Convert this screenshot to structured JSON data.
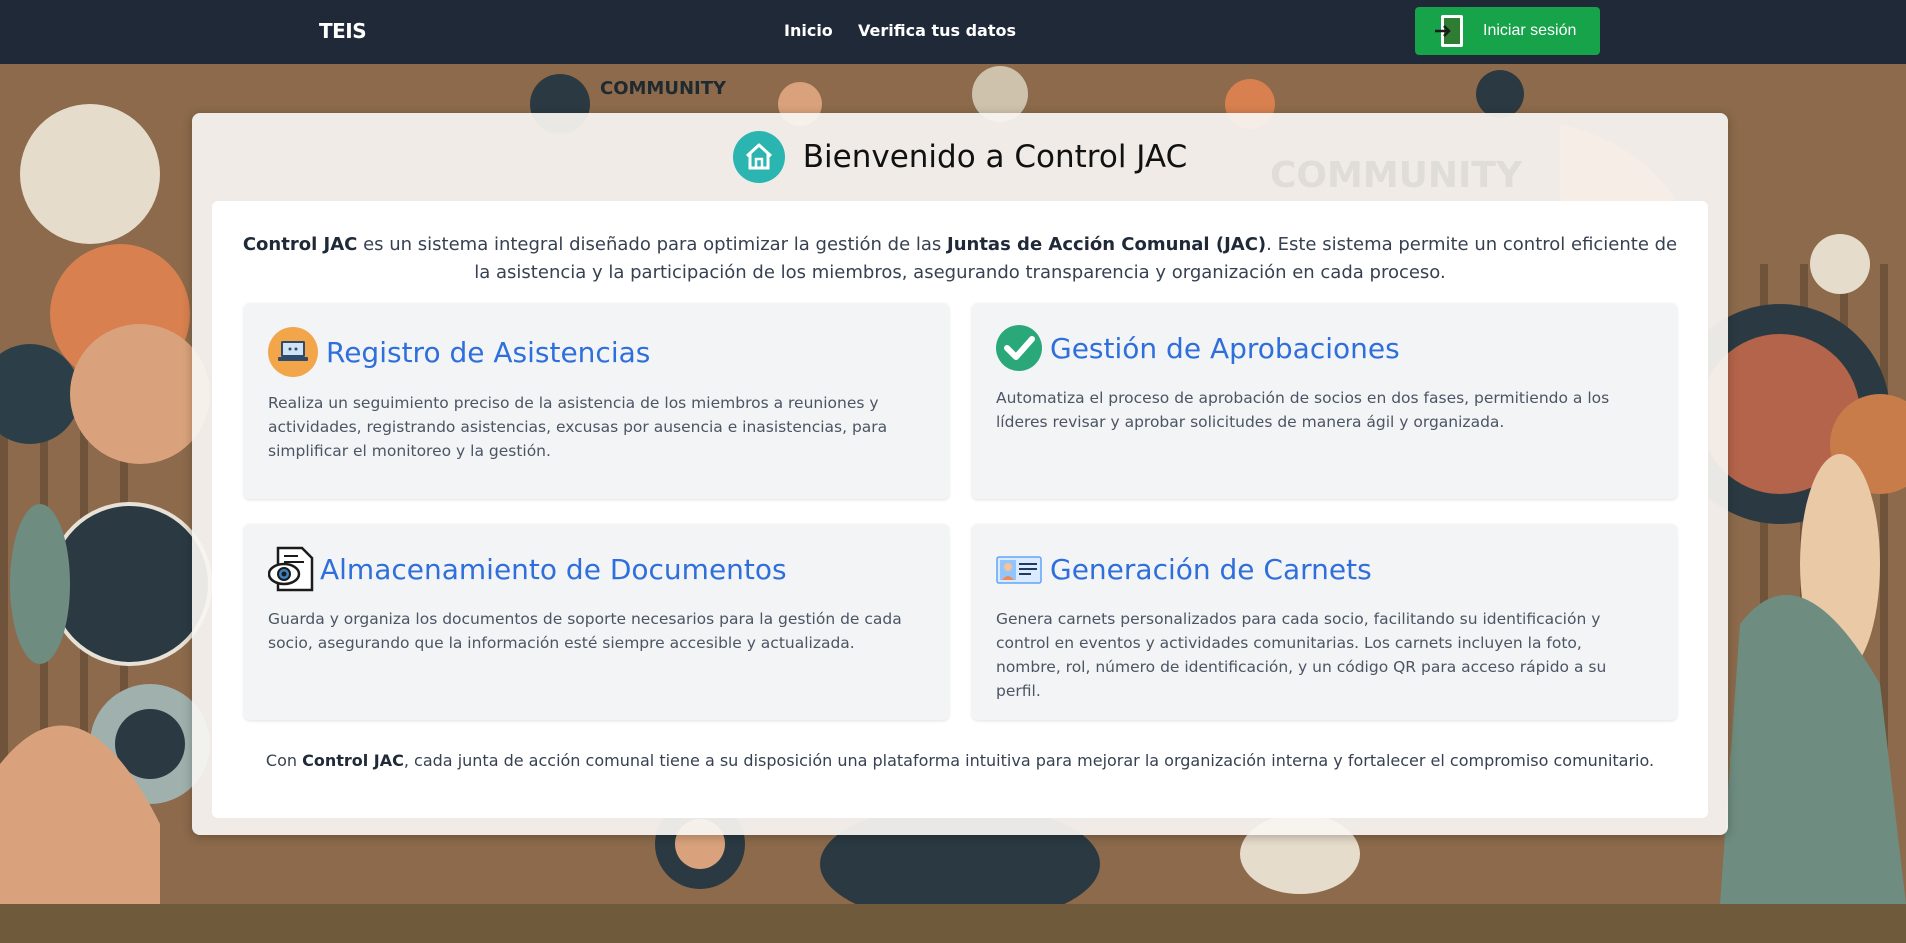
{
  "navbar": {
    "brand": "TEIS",
    "links": [
      "Inicio",
      "Verifica tus datos"
    ],
    "login_label": "Iniciar sesión"
  },
  "background": {
    "art_text_1": "COMMUNITY",
    "art_text_2": "COMMUNITY"
  },
  "main": {
    "title": "Bienvenido a Control JAC",
    "intro": {
      "part1": "Control JAC",
      "part2": " es un sistema integral diseñado para optimizar la gestión de las ",
      "part3": "Juntas de Acción Comunal (JAC)",
      "part4": ". Este sistema permite un control eficiente de la asistencia y la participación de los miembros, asegurando transparencia y organización en cada proceso."
    },
    "features": [
      {
        "title": "Registro de Asistencias",
        "icon": "laptop-icon",
        "description": "Realiza un seguimiento preciso de la asistencia de los miembros a reuniones y actividades, registrando asistencias, excusas por ausencia e inasistencias, para simplificar el monitoreo y la gestión."
      },
      {
        "title": "Gestión de Aprobaciones",
        "icon": "check-circle-icon",
        "description": "Automatiza el proceso de aprobación de socios en dos fases, permitiendo a los líderes revisar y aprobar solicitudes de manera ágil y organizada."
      },
      {
        "title": "Almacenamiento de Documentos",
        "icon": "document-eye-icon",
        "description": "Guarda y organiza los documentos de soporte necesarios para la gestión de cada socio, asegurando que la información esté siempre accesible y actualizada."
      },
      {
        "title": "Generación de Carnets",
        "icon": "id-card-icon",
        "description": "Genera carnets personalizados para cada socio, facilitando su identificación y control en eventos y actividades comunitarias. Los carnets incluyen la foto, nombre, rol, número de identificación, y un código QR para acceso rápido a su perfil."
      }
    ],
    "outro": {
      "part1": "Con ",
      "part2": "Control JAC",
      "part3": ", cada junta de acción comunal tiene a su disposición una plataforma intuitiva para mejorar la organización interna y fortalecer el compromiso comunitario."
    }
  },
  "colors": {
    "navbar_bg": "#1f2937",
    "login_button": "#16a34a",
    "feature_title": "#2f6fdc",
    "home_icon": "#2bb5b0"
  }
}
